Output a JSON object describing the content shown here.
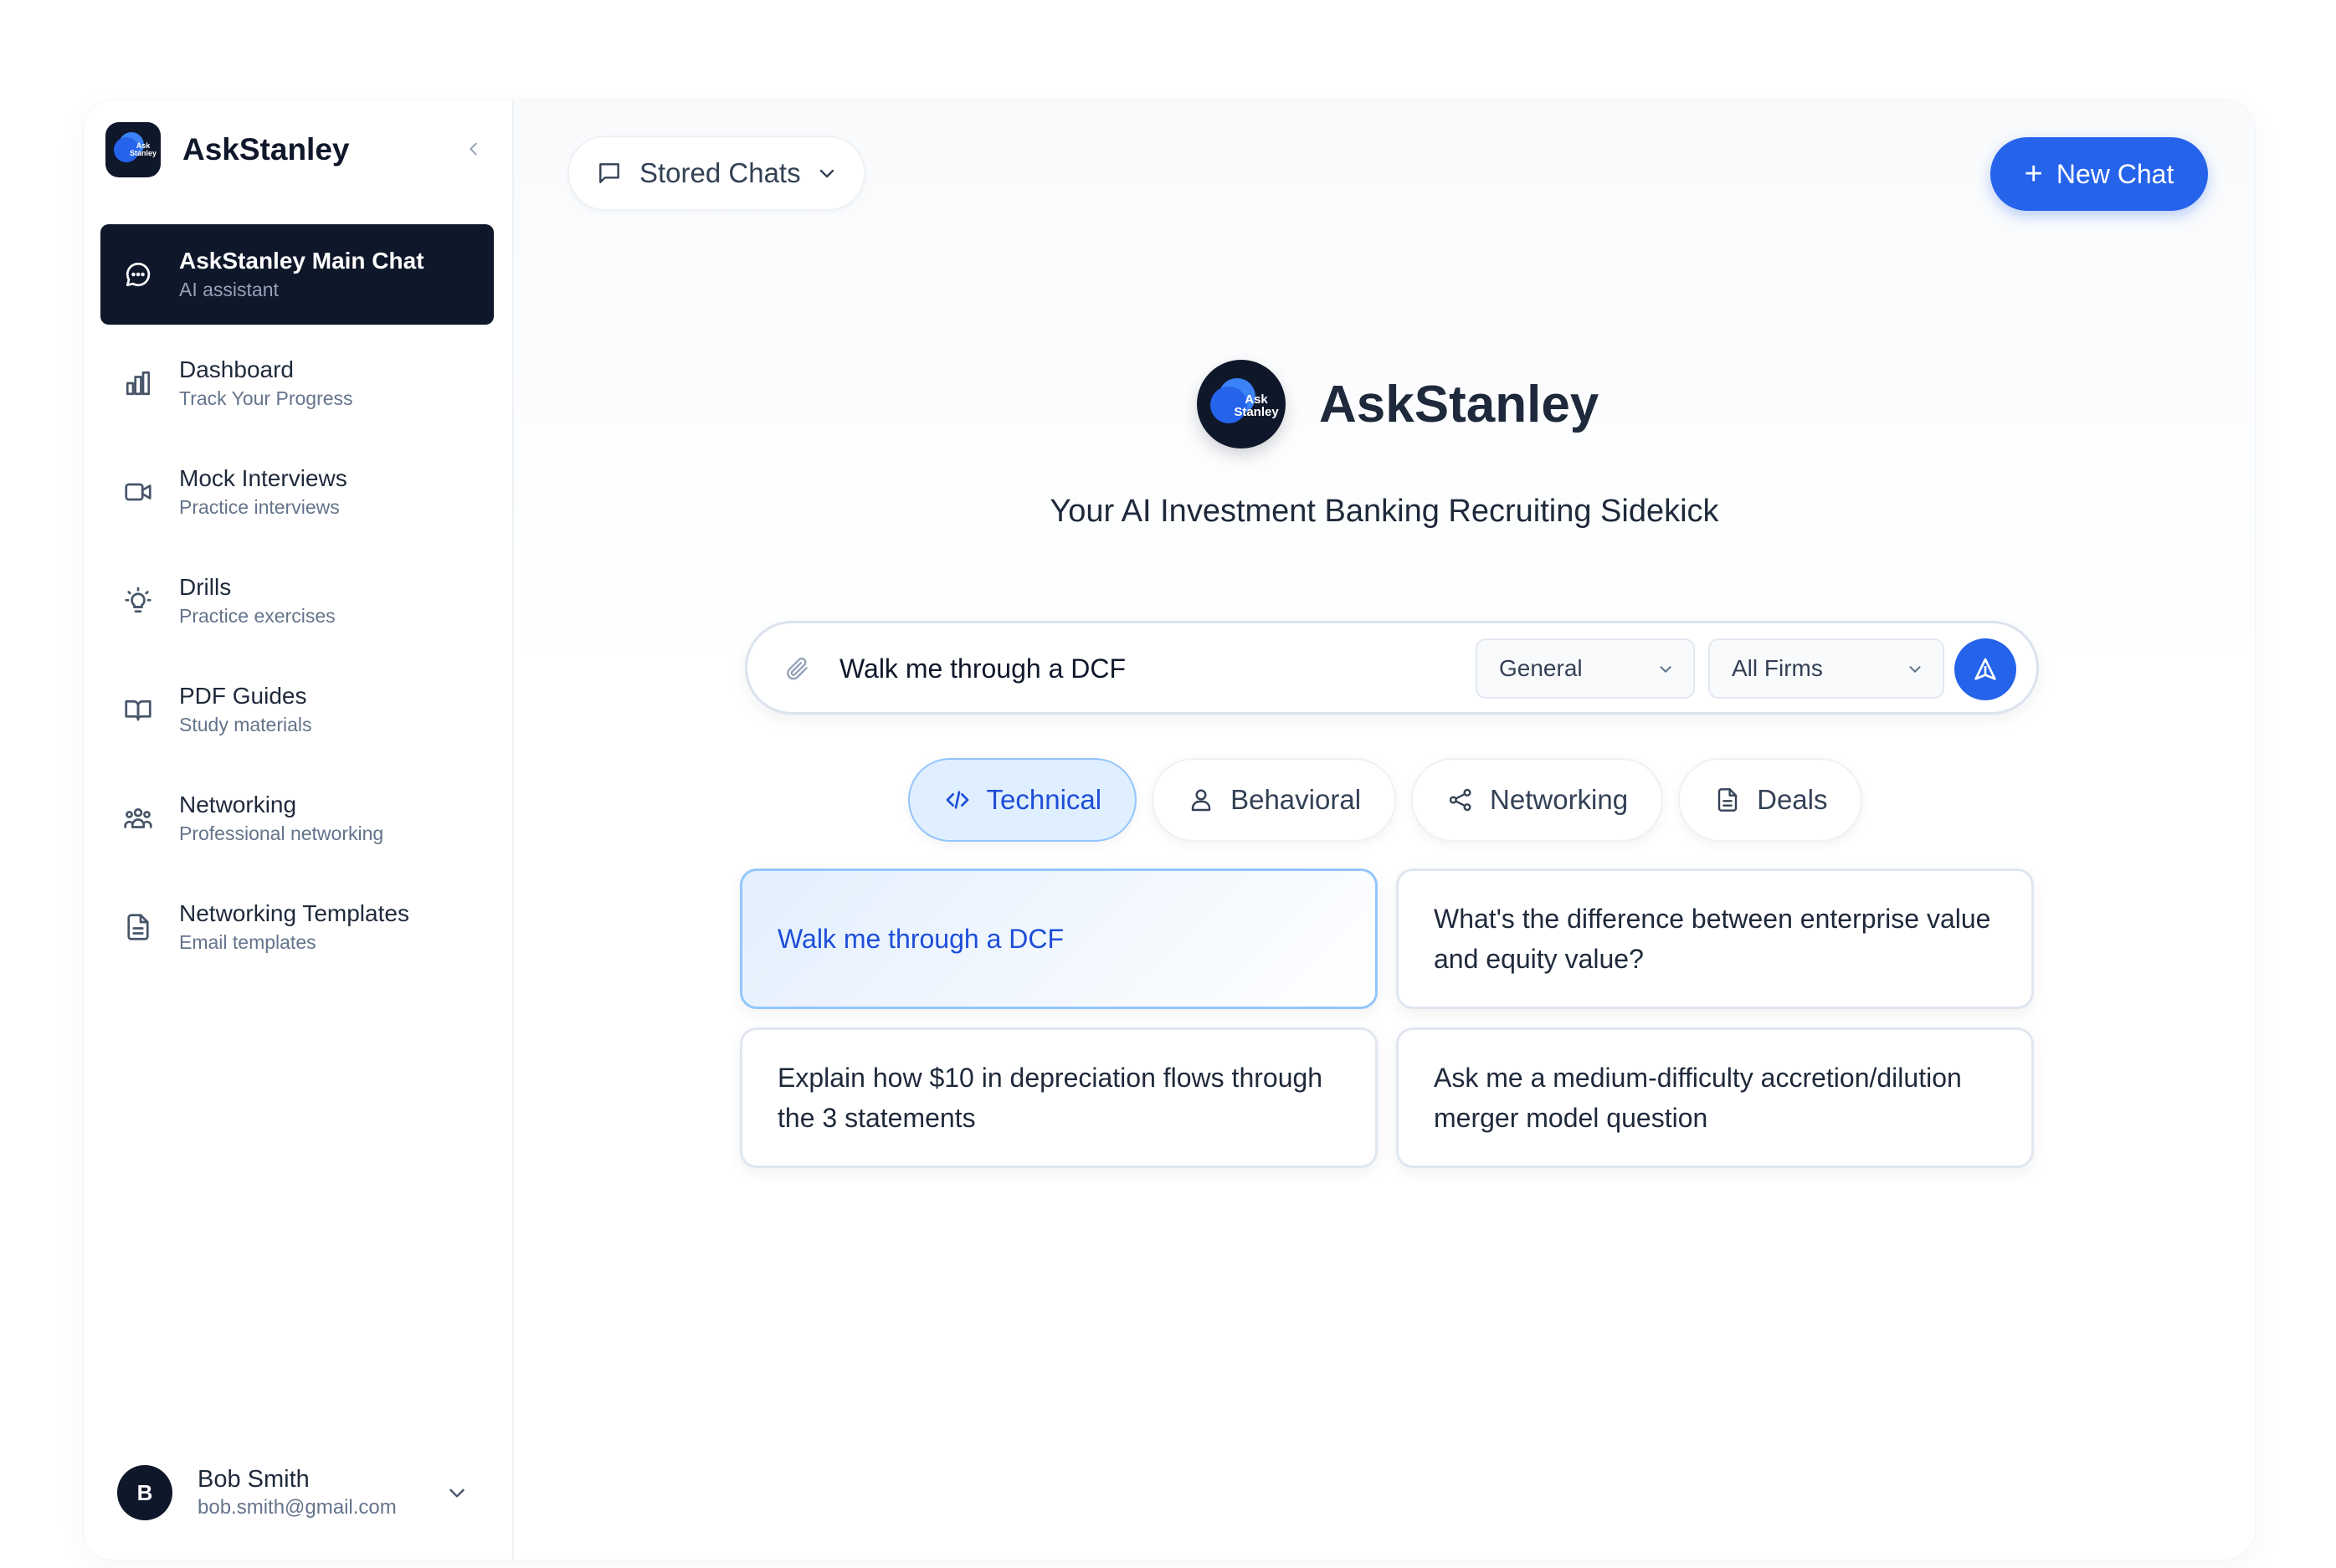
{
  "brand": {
    "name": "AskStanley",
    "logo_text": "Ask Stanley"
  },
  "sidebar": {
    "items": [
      {
        "label": "AskStanley Main Chat",
        "sub": "AI assistant",
        "icon": "chat-bubble-icon"
      },
      {
        "label": "Dashboard",
        "sub": "Track Your Progress",
        "icon": "bar-chart-icon"
      },
      {
        "label": "Mock Interviews",
        "sub": "Practice interviews",
        "icon": "video-camera-icon"
      },
      {
        "label": "Drills",
        "sub": "Practice exercises",
        "icon": "lightbulb-icon"
      },
      {
        "label": "PDF Guides",
        "sub": "Study materials",
        "icon": "open-book-icon"
      },
      {
        "label": "Networking",
        "sub": "Professional networking",
        "icon": "people-icon"
      },
      {
        "label": "Networking Templates",
        "sub": "Email templates",
        "icon": "document-icon"
      }
    ],
    "user": {
      "initial": "B",
      "name": "Bob Smith",
      "email": "bob.smith@gmail.com"
    }
  },
  "toolbar": {
    "stored_chats_label": "Stored Chats",
    "new_chat_label": "New Chat",
    "new_chat_plus": "+"
  },
  "hero": {
    "title": "AskStanley",
    "subtitle": "Your AI Investment Banking Recruiting Sidekick"
  },
  "composer": {
    "value": "Walk me through a DCF",
    "category_selected": "General",
    "firm_selected": "All Firms"
  },
  "tabs": [
    {
      "label": "Technical",
      "icon": "code-icon",
      "active": true
    },
    {
      "label": "Behavioral",
      "icon": "user-icon",
      "active": false
    },
    {
      "label": "Networking",
      "icon": "share-nodes-icon",
      "active": false
    },
    {
      "label": "Deals",
      "icon": "document-icon",
      "active": false
    }
  ],
  "suggestions": [
    "Walk me through a DCF",
    "What's the difference between enterprise value and equity value?",
    "Explain how $10 in depreciation flows through the 3 statements",
    "Ask me a medium-difficulty accretion/dilution merger model question"
  ],
  "colors": {
    "accent": "#2563eb",
    "sidebar_active": "#0f172a",
    "tab_active_bg": "#e0efff"
  }
}
